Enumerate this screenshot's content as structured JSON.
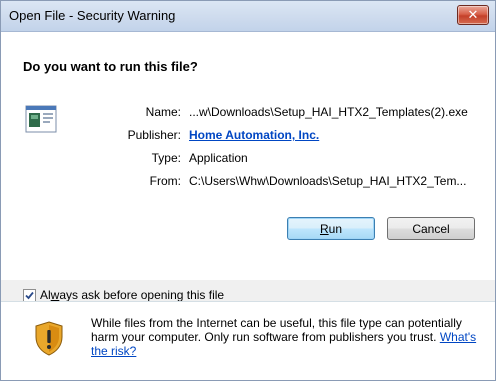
{
  "window": {
    "title": "Open File - Security Warning",
    "close_label": "✕"
  },
  "prompt": {
    "heading": "Do you want to run this file?"
  },
  "fields": {
    "name_label": "Name:",
    "name_value": "...w\\Downloads\\Setup_HAI_HTX2_Templates(2).exe",
    "publisher_label": "Publisher:",
    "publisher_value": "Home Automation, Inc.",
    "type_label": "Type:",
    "type_value": "Application",
    "from_label": "From:",
    "from_value": "C:\\Users\\Whw\\Downloads\\Setup_HAI_HTX2_Tem..."
  },
  "buttons": {
    "run_prefix": "",
    "run_accel": "R",
    "run_rest": "un",
    "cancel_label": "Cancel"
  },
  "checkbox": {
    "checked": true,
    "check_mark": "✓",
    "label_prefix": "Al",
    "label_accel": "w",
    "label_rest": "ays ask before opening this file"
  },
  "info": {
    "text": "While files from the Internet can be useful, this file type can potentially harm your computer. Only run software from publishers you trust.",
    "risk_link": "What's the risk?"
  },
  "colors": {
    "link": "#0046c3",
    "close_button": "#c4402a",
    "default_button_border": "#3c7fb1"
  },
  "icons": {
    "file": "application-file-icon",
    "warning": "security-shield-warning-icon",
    "close": "close-icon"
  }
}
